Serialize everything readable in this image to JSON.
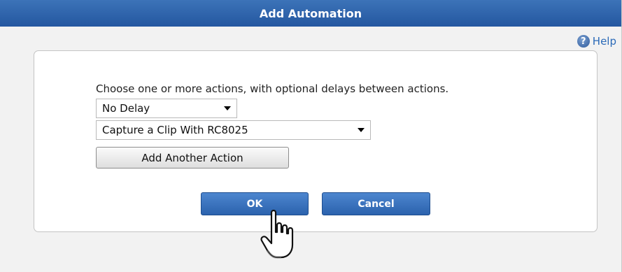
{
  "dialog": {
    "title": "Add Automation",
    "help_label": "Help",
    "instructions": "Choose one or more actions, with optional delays between actions.",
    "delay_select": {
      "selected": "No Delay"
    },
    "action_select": {
      "selected": "Capture a Clip With RC8025"
    },
    "add_action_label": "Add Another Action",
    "ok_label": "OK",
    "cancel_label": "Cancel"
  },
  "colors": {
    "title_bar": "#2a5ea8",
    "primary_button": "#3a72bd",
    "help_link": "#2a6ab8"
  },
  "icons": [
    "help-icon",
    "dropdown-arrow-icon",
    "hand-pointer-cursor-icon"
  ]
}
